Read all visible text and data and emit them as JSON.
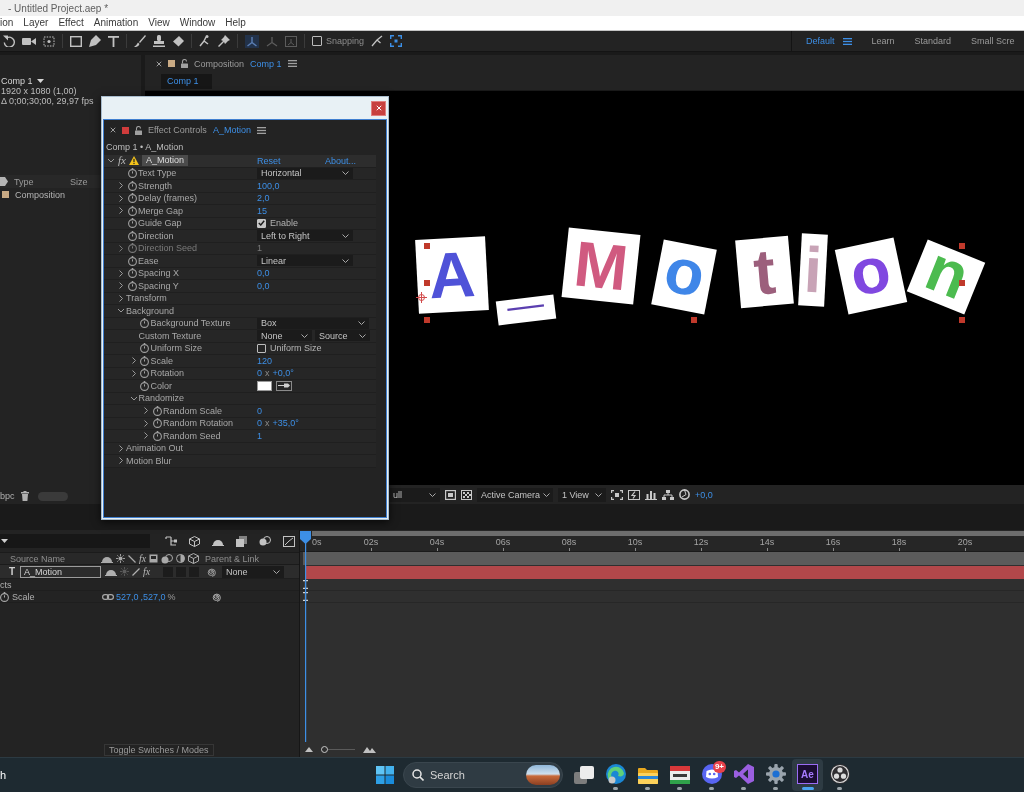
{
  "title_bar": {
    "title": "- Untitled Project.aep *"
  },
  "menu_bar": {
    "items": [
      "ion",
      "Layer",
      "Effect",
      "Animation",
      "View",
      "Window",
      "Help"
    ]
  },
  "toolbar": {
    "snapping": {
      "label": "Snapping",
      "checked": false
    },
    "workspaces": [
      {
        "label": "Default",
        "selected": true
      },
      {
        "label": "Learn",
        "selected": false
      },
      {
        "label": "Standard",
        "selected": false
      },
      {
        "label": "Small Scre",
        "selected": false
      }
    ]
  },
  "project_panel": {
    "comp_name": "Comp 1",
    "comp_info": [
      "1920 x 1080 (1,00)",
      "Δ 0;00;30;00, 29,97 fps"
    ],
    "columns": [
      "Type",
      "Size"
    ],
    "items": [
      {
        "type": "Composition",
        "color": "#c9aa84"
      }
    ],
    "bit_depth": "bpc"
  },
  "composition_panel": {
    "title": "Composition",
    "comp": "Comp 1",
    "tab": "Comp 1",
    "letters": [
      {
        "char": "A",
        "color": "#4f52d8"
      },
      {
        "char": "_",
        "color": "#5b3fb0"
      },
      {
        "char": "M",
        "color": "#d05a80"
      },
      {
        "char": "o",
        "color": "#3f86e8"
      },
      {
        "char": "t",
        "color": "#9c5f7c"
      },
      {
        "char": "i",
        "color": "#c8a3b6"
      },
      {
        "char": "o",
        "color": "#8048e0"
      },
      {
        "char": "n",
        "color": "#4cbb4f"
      }
    ],
    "viewer_bar": {
      "resolution": "ull",
      "camera": "Active Camera",
      "views": "1 View",
      "exposure": "+0,0"
    }
  },
  "effect_controls": {
    "title": "Effect Controls",
    "layer": "A_Motion",
    "breadcrumb": "Comp 1 • A_Motion",
    "effect": {
      "fx": "fx",
      "name": "A_Motion",
      "expanded": true,
      "reset": "Reset",
      "about": "About...",
      "properties": [
        {
          "kind": "dropdown",
          "label": "Text Type",
          "value": "Horizontal",
          "disabled": false
        },
        {
          "kind": "number",
          "label": "Strength",
          "value": "100,0",
          "expanded": false,
          "disabled": false
        },
        {
          "kind": "number",
          "label": "Delay (frames)",
          "value": "2,0",
          "expanded": false,
          "disabled": false
        },
        {
          "kind": "number",
          "label": "Merge Gap",
          "value": "15",
          "expanded": false,
          "disabled": false
        },
        {
          "kind": "checkbox",
          "label": "Guide Gap",
          "value": "Enable",
          "checked": true,
          "disabled": false
        },
        {
          "kind": "dropdown",
          "label": "Direction",
          "value": "Left to Right",
          "disabled": false
        },
        {
          "kind": "number",
          "label": "Direction Seed",
          "value": "1",
          "expanded": false,
          "disabled": true
        },
        {
          "kind": "dropdown",
          "label": "Ease",
          "value": "Linear",
          "disabled": false
        },
        {
          "kind": "number",
          "label": "Spacing X",
          "value": "0,0",
          "expanded": false,
          "disabled": false
        },
        {
          "kind": "number",
          "label": "Spacing Y",
          "value": "0,0",
          "expanded": false,
          "disabled": false
        },
        {
          "kind": "group",
          "label": "Transform",
          "expanded": false
        },
        {
          "kind": "group",
          "label": "Background",
          "expanded": true,
          "children": [
            {
              "kind": "dropdown",
              "label": "Background Texture",
              "value": "Box",
              "disabled": false
            },
            {
              "kind": "dropdown_pair",
              "label": "Custom Texture",
              "values": [
                "None",
                "Source"
              ],
              "disabled": false
            },
            {
              "kind": "checkbox",
              "label": "Uniform Size",
              "value": "Uniform Size",
              "checked": false,
              "disabled": false
            },
            {
              "kind": "number",
              "label": "Scale",
              "value": "120",
              "expanded": false,
              "disabled": false
            },
            {
              "kind": "angle",
              "label": "Rotation",
              "revolutions": "0",
              "separator": "x",
              "degrees": "+0,0°",
              "expanded": false,
              "disabled": false
            },
            {
              "kind": "color",
              "label": "Color",
              "color": "#ffffff",
              "disabled": false
            },
            {
              "kind": "group",
              "label": "Randomize",
              "expanded": true,
              "children": [
                {
                  "kind": "number",
                  "label": "Random Scale",
                  "value": "0",
                  "expanded": false,
                  "disabled": false
                },
                {
                  "kind": "angle",
                  "label": "Random Rotation",
                  "revolutions": "0",
                  "separator": "x",
                  "degrees": "+35,0°",
                  "expanded": false,
                  "disabled": false
                },
                {
                  "kind": "number",
                  "label": "Random Seed",
                  "value": "1",
                  "expanded": false,
                  "disabled": false
                }
              ]
            }
          ]
        },
        {
          "kind": "group",
          "label": "Animation Out",
          "expanded": false
        },
        {
          "kind": "group",
          "label": "Motion Blur",
          "expanded": false
        }
      ]
    }
  },
  "timeline": {
    "ruler": [
      "0s",
      "02s",
      "04s",
      "06s",
      "08s",
      "10s",
      "12s",
      "14s",
      "16s",
      "18s",
      "20s"
    ],
    "columns": {
      "source_name": "Source Name",
      "fx": "fx",
      "parent": "Parent & Link"
    },
    "layers": [
      {
        "type_glyph": "T",
        "name": "A_Motion",
        "fx": "fx",
        "fx_enabled": true,
        "parent": "None"
      }
    ],
    "properties": [
      {
        "kind": "group",
        "label": "cts"
      },
      {
        "kind": "property",
        "label": "Scale",
        "values": [
          "527,0",
          ",527,0"
        ],
        "unit": "%"
      }
    ],
    "footer": "Toggle Switches / Modes",
    "zoom": {
      "level": 0.1
    }
  },
  "taskbar": {
    "left_text": "h",
    "search": {
      "placeholder": "Search"
    },
    "apps": [
      {
        "kind": "task_view",
        "running": false,
        "selected": false
      },
      {
        "kind": "browser",
        "running": true,
        "selected": false
      },
      {
        "kind": "folder",
        "running": true,
        "selected": false
      },
      {
        "kind": "window",
        "running": true,
        "selected": false
      },
      {
        "kind": "chat",
        "running": true,
        "selected": false,
        "badge": "9+"
      },
      {
        "kind": "ide",
        "running": true,
        "selected": false
      },
      {
        "kind": "settings",
        "running": true,
        "selected": false
      },
      {
        "kind": "tile",
        "label": "Ae",
        "running": true,
        "selected": true
      },
      {
        "kind": "recorder",
        "running": true,
        "selected": false
      }
    ]
  }
}
